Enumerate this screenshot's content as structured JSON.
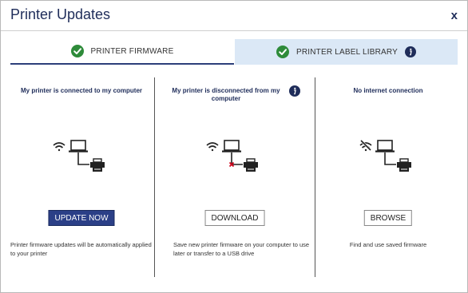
{
  "dialog": {
    "title": "Printer Updates",
    "close_label": "x"
  },
  "tabs": [
    {
      "label": "PRINTER FIRMWARE",
      "icon": "check-circle-icon"
    },
    {
      "label": "PRINTER LABEL LIBRARY",
      "icon": "check-circle-icon",
      "info_icon": "info-icon"
    }
  ],
  "options": [
    {
      "heading": "My printer is connected to my computer",
      "button": "UPDATE NOW",
      "description": "Printer firmware updates will be automatically applied to your printer"
    },
    {
      "heading": "My printer is disconnected from my computer",
      "button": "DOWNLOAD",
      "description": "Save new printer firmware on your computer to use later or transfer to a USB drive"
    },
    {
      "heading": "No internet connection",
      "button": "BROWSE",
      "description": "Find and use saved firmware"
    }
  ],
  "colors": {
    "accent": "#2b3f87",
    "title": "#1f2d5a",
    "check": "#2e8b3a",
    "tab_active_bg": "#dbe8f6",
    "error": "#d0021b"
  }
}
